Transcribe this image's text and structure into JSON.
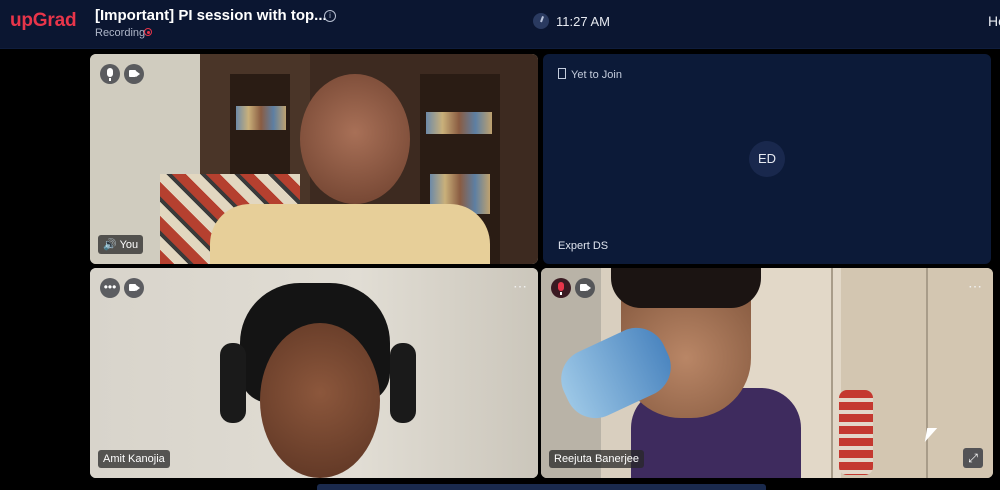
{
  "header": {
    "logo": "upGrad",
    "title": "[Important] PI session with top...",
    "status": "Recording",
    "time": "11:27 AM",
    "right_cut": "He"
  },
  "tiles": [
    {
      "name": "You"
    },
    {
      "status": "Yet to Join",
      "avatar": "ED",
      "name": "Expert DS"
    },
    {
      "name": "Amit Kanojia"
    },
    {
      "name": "Reejuta Banerjee"
    }
  ],
  "colors": {
    "brand": "#e8354a",
    "topbar": "#0b1631",
    "tile_dark": "#0c1a38"
  }
}
